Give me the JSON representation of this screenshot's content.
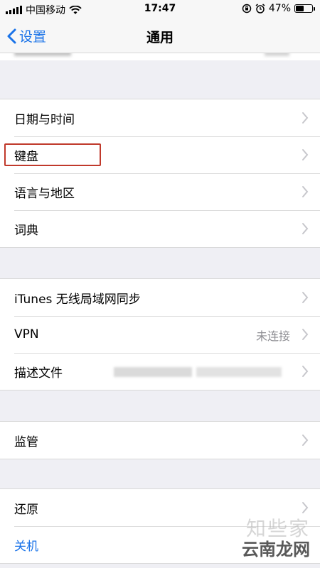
{
  "status_bar": {
    "carrier": "中国移动",
    "time": "17:47",
    "battery": "47%",
    "battery_level": 0.47
  },
  "nav": {
    "back_label": "设置",
    "title": "通用"
  },
  "group1": [
    {
      "label": "日期与时间"
    },
    {
      "label": "键盘"
    },
    {
      "label": "语言与地区"
    },
    {
      "label": "词典"
    }
  ],
  "group2": [
    {
      "label": "iTunes 无线局域网同步"
    },
    {
      "label": "VPN",
      "value": "未连接"
    },
    {
      "label": "描述文件"
    }
  ],
  "group3": [
    {
      "label": "监管"
    }
  ],
  "group4": [
    {
      "label": "还原"
    },
    {
      "label": "关机"
    }
  ],
  "watermark": {
    "top": "知些家",
    "bottom": "云南龙网"
  },
  "colors": {
    "accent": "#1a73e8",
    "highlight": "#c0392b",
    "background": "#efeff4"
  }
}
